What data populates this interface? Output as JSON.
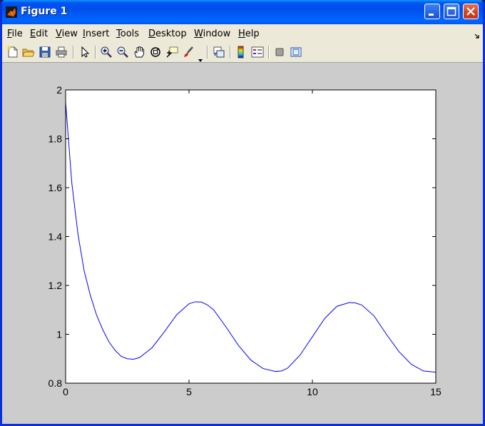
{
  "window": {
    "title": "Figure 1"
  },
  "menu": [
    {
      "label": "File",
      "u": "F",
      "rest": "ile"
    },
    {
      "label": "Edit",
      "u": "E",
      "rest": "dit"
    },
    {
      "label": "View",
      "u": "V",
      "rest": "iew"
    },
    {
      "label": "Insert",
      "u": "I",
      "rest": "nsert"
    },
    {
      "label": "Tools",
      "u": "T",
      "rest": "ools"
    },
    {
      "label": "Desktop",
      "u": "D",
      "rest": "esktop"
    },
    {
      "label": "Window",
      "u": "W",
      "rest": "indow"
    },
    {
      "label": "Help",
      "u": "H",
      "rest": "elp"
    }
  ],
  "toolbar_icons": [
    "new-figure-icon",
    "open-file-icon",
    "save-icon",
    "print-icon",
    "edit-plot-icon",
    "zoom-in-icon",
    "zoom-out-icon",
    "pan-icon",
    "rotate-3d-icon",
    "data-cursor-icon",
    "brush-icon",
    "link-plot-icon",
    "colorbar-icon",
    "legend-icon",
    "hide-plot-tools-icon",
    "show-plot-tools-icon"
  ],
  "colors": {
    "line": "#0000FF",
    "title_bar": "#0053EE",
    "figure_bg": "#CCCCCC",
    "axes_bg": "#FFFFFF"
  },
  "chart_data": {
    "type": "line",
    "title": "",
    "xlabel": "",
    "ylabel": "",
    "xlim": [
      0,
      15
    ],
    "ylim": [
      0.8,
      2
    ],
    "xticks": [
      0,
      5,
      10,
      15
    ],
    "yticks": [
      0.8,
      1,
      1.2,
      1.4,
      1.6,
      1.8,
      2
    ],
    "xtick_labels": [
      "0",
      "5",
      "10",
      "15"
    ],
    "ytick_labels": [
      "0.8",
      "1",
      "1.2",
      "1.4",
      "1.6",
      "1.8",
      "2"
    ],
    "grid": false,
    "series": [
      {
        "color": "#0000FF",
        "x": [
          0,
          0.25,
          0.5,
          0.75,
          1.0,
          1.25,
          1.5,
          1.75,
          2.0,
          2.25,
          2.5,
          2.75,
          3.0,
          3.5,
          4.0,
          4.5,
          5.0,
          5.25,
          5.5,
          5.75,
          6.0,
          6.5,
          7.0,
          7.5,
          8.0,
          8.5,
          8.75,
          9.0,
          9.5,
          10.0,
          10.5,
          11.0,
          11.5,
          11.75,
          12.0,
          12.5,
          13.0,
          13.5,
          14.0,
          14.5,
          15.0
        ],
        "y": [
          1.95,
          1.62,
          1.41,
          1.26,
          1.16,
          1.08,
          1.02,
          0.97,
          0.935,
          0.91,
          0.9,
          0.898,
          0.905,
          0.945,
          1.01,
          1.08,
          1.125,
          1.133,
          1.132,
          1.12,
          1.1,
          1.03,
          0.955,
          0.895,
          0.86,
          0.848,
          0.85,
          0.862,
          0.915,
          0.99,
          1.065,
          1.115,
          1.13,
          1.128,
          1.12,
          1.075,
          1.0,
          0.93,
          0.878,
          0.85,
          0.845
        ]
      }
    ]
  }
}
